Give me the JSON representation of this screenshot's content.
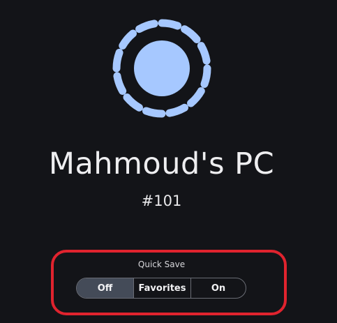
{
  "device": {
    "avatar_icon": "device-avatar-icon",
    "avatar_color": "#a6c8ff",
    "name": "Mahmoud's PC",
    "id_label": "#101"
  },
  "quick_save": {
    "label": "Quick Save",
    "options": [
      "Off",
      "Favorites",
      "On"
    ],
    "selected": "Off"
  },
  "colors": {
    "background": "#131418",
    "highlight": "#e0232e",
    "selected_segment": "#444b58"
  }
}
